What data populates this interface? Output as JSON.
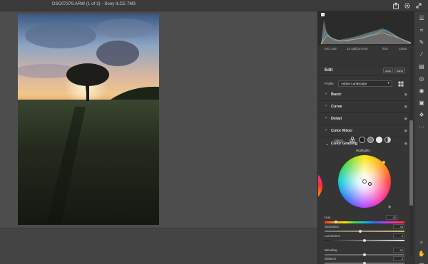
{
  "titlebar": {
    "title": "DSC07379.ARW (1 of 3)  ·  Sony ILCE-7M3"
  },
  "meta": {
    "iso": "ISO 100",
    "lens": "11-18@10 mm",
    "aperture": "f/16",
    "shutter": "1/25s"
  },
  "edit": {
    "title": "Edit",
    "auto_label": "Auto",
    "bw_label": "B&W"
  },
  "profile": {
    "label": "Profile",
    "value": "Adobe Landscape"
  },
  "sections": [
    {
      "label": "Basic"
    },
    {
      "label": "Curve"
    },
    {
      "label": "Detail"
    },
    {
      "label": "Color Mixer"
    }
  ],
  "color_grading": {
    "title": "Color Grading",
    "adjust_label": "Adjust",
    "wheel_title": "Highlights",
    "hue": {
      "label": "Hue",
      "value": "40"
    },
    "saturation": {
      "label": "Saturation",
      "value": "45",
      "level": 0.45
    },
    "luminance": {
      "label": "Luminance",
      "value": "0",
      "level": 0.5
    },
    "blending": {
      "label": "Blending",
      "value": "50",
      "level": 0.5
    },
    "balance": {
      "label": "Balance",
      "value": "0",
      "level": 0.5
    }
  },
  "colors": {
    "accent": "#f2c23a",
    "panel": "#353535",
    "canvas": "#4d4d4d"
  }
}
